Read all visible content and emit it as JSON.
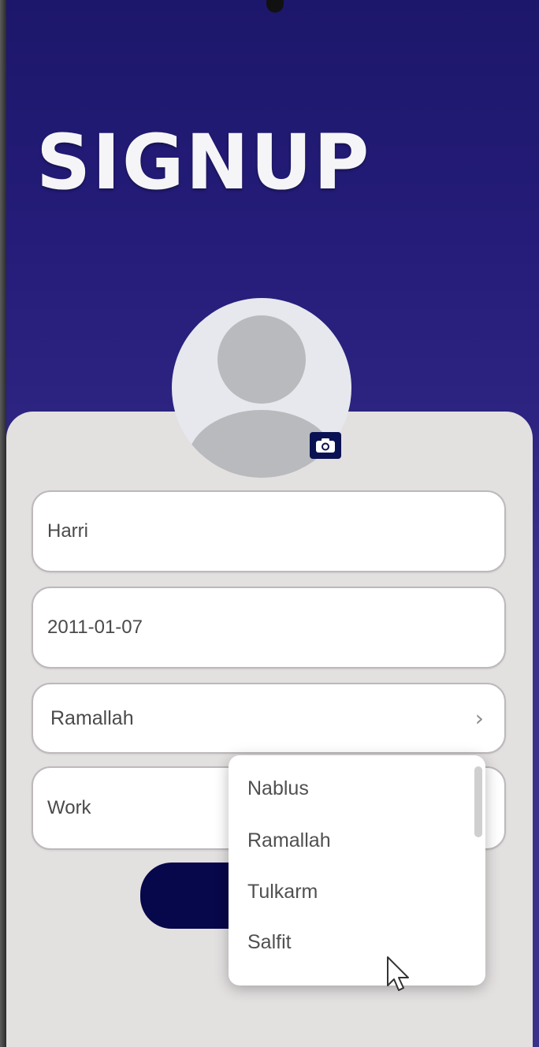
{
  "header": {
    "title": "SIGNUP"
  },
  "form": {
    "name_value": "Harri",
    "birthdate_value": "2011-01-07",
    "city_value": "Ramallah",
    "work_value": "Work"
  },
  "city_dropdown": {
    "options": [
      "Nablus",
      "Ramallah",
      "Tulkarm",
      "Salfit"
    ]
  },
  "icons": {
    "camera": "camera-icon",
    "chevron": "chevron-right-icon",
    "avatar": "person-avatar-icon"
  },
  "colors": {
    "header_bg": "#241c78",
    "card_bg": "#e3e0e0",
    "button": "#07074b",
    "field_bg": "#ffffff"
  }
}
